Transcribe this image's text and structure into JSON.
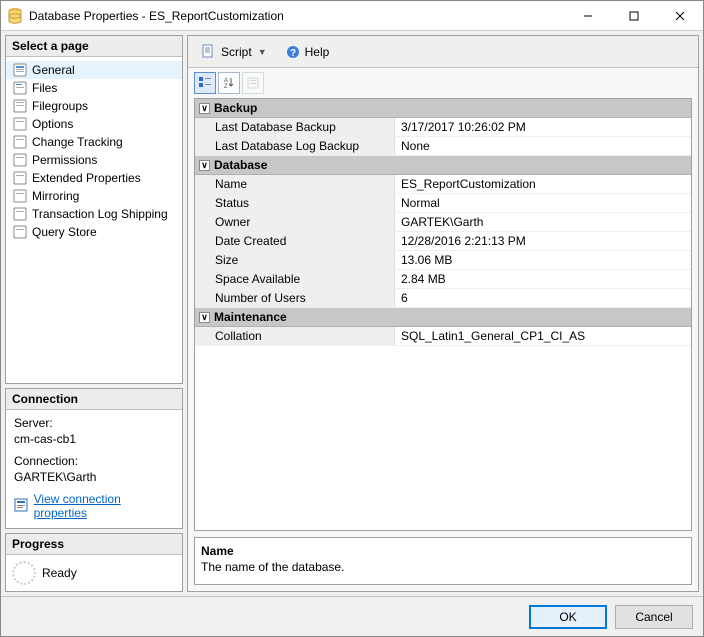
{
  "window": {
    "title": "Database Properties - ES_ReportCustomization"
  },
  "nav": {
    "heading": "Select a page",
    "items": [
      {
        "label": "General"
      },
      {
        "label": "Files"
      },
      {
        "label": "Filegroups"
      },
      {
        "label": "Options"
      },
      {
        "label": "Change Tracking"
      },
      {
        "label": "Permissions"
      },
      {
        "label": "Extended Properties"
      },
      {
        "label": "Mirroring"
      },
      {
        "label": "Transaction Log Shipping"
      },
      {
        "label": "Query Store"
      }
    ]
  },
  "connection": {
    "heading": "Connection",
    "server_label": "Server:",
    "server": "cm-cas-cb1",
    "conn_label": "Connection:",
    "conn": "GARTEK\\Garth",
    "link": "View connection properties"
  },
  "progress": {
    "heading": "Progress",
    "status": "Ready"
  },
  "toolbar": {
    "script": "Script",
    "help": "Help"
  },
  "props": {
    "cat_backup": "Backup",
    "last_db_backup_label": "Last Database Backup",
    "last_db_backup": "3/17/2017 10:26:02 PM",
    "last_log_backup_label": "Last Database Log Backup",
    "last_log_backup": "None",
    "cat_database": "Database",
    "name_label": "Name",
    "name": "ES_ReportCustomization",
    "status_label": "Status",
    "status": "Normal",
    "owner_label": "Owner",
    "owner": "GARTEK\\Garth",
    "datecreated_label": "Date Created",
    "datecreated": "12/28/2016 2:21:13 PM",
    "size_label": "Size",
    "size": "13.06 MB",
    "space_label": "Space Available",
    "space": "2.84 MB",
    "users_label": "Number of Users",
    "users": "6",
    "cat_maint": "Maintenance",
    "collation_label": "Collation",
    "collation": "SQL_Latin1_General_CP1_CI_AS"
  },
  "desc": {
    "title": "Name",
    "text": "The name of the database."
  },
  "buttons": {
    "ok": "OK",
    "cancel": "Cancel"
  }
}
